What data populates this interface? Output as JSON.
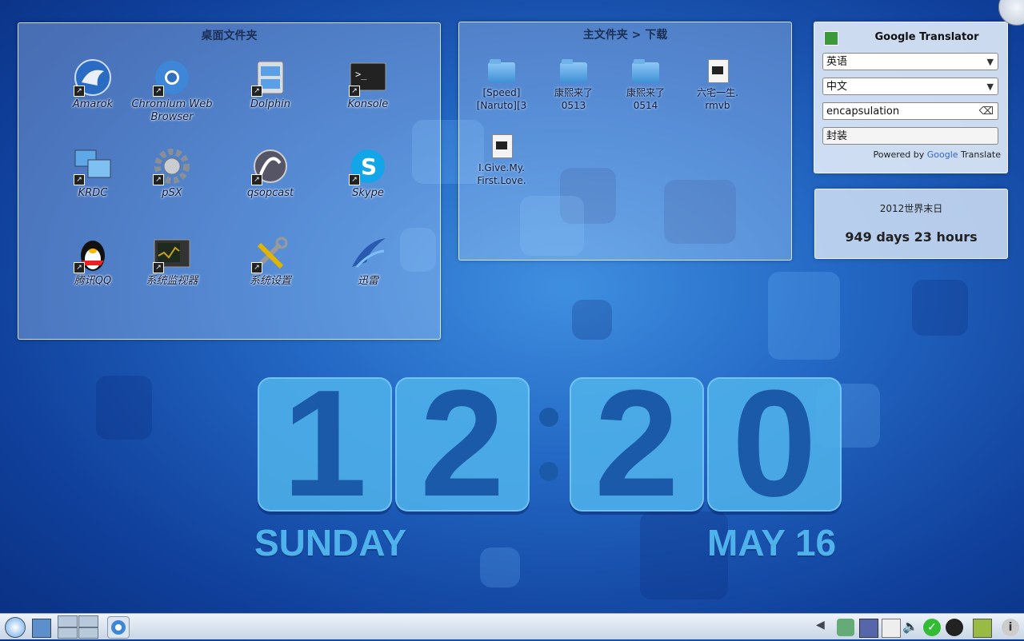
{
  "desktop_panel": {
    "title": "桌面文件夹",
    "icons": [
      {
        "label": "Amarok",
        "icon": "amarok-icon"
      },
      {
        "label": "Chromium Web Browser",
        "icon": "chromium-icon"
      },
      {
        "label": "Dolphin",
        "icon": "dolphin-icon"
      },
      {
        "label": "Konsole",
        "icon": "konsole-icon"
      },
      {
        "label": "KRDC",
        "icon": "krdc-icon"
      },
      {
        "label": "pSX",
        "icon": "psx-gear-icon"
      },
      {
        "label": "qsopcast",
        "icon": "qsopcast-icon"
      },
      {
        "label": "Skype",
        "icon": "skype-icon"
      },
      {
        "label": "腾讯QQ",
        "icon": "qq-penguin-icon"
      },
      {
        "label": "系统监视器",
        "icon": "system-monitor-icon"
      },
      {
        "label": "系统设置",
        "icon": "system-settings-icon"
      },
      {
        "label": "迅雷",
        "icon": "xunlei-icon"
      }
    ]
  },
  "home_panel": {
    "title": "主文件夹 > 下载",
    "files": [
      {
        "label": "[Speed]\n[Naruto][3",
        "type": "folder-icon"
      },
      {
        "label": "康熙来了\n0513",
        "type": "folder-icon"
      },
      {
        "label": "康熙来了\n0514",
        "type": "folder-icon"
      },
      {
        "label": "六宅一生.\nrmvb",
        "type": "video-file-icon"
      },
      {
        "label": "I.Give.My.\nFirst.Love.",
        "type": "video-file-icon"
      }
    ]
  },
  "translator": {
    "title": "Google Translator",
    "from_lang": "英语",
    "to_lang": "中文",
    "input_text": "encapsulation",
    "output_text": "封装",
    "powered_by": "Powered by",
    "google": "Google",
    "translate": "Translate"
  },
  "countdown": {
    "title": "2012世界末日",
    "value": "949 days 23 hours"
  },
  "clock": {
    "h1": "1",
    "h2": "2",
    "m1": "2",
    "m2": "0",
    "day": "SUNDAY",
    "date": "MAY 16"
  },
  "taskbar": {
    "icons": [
      "kickoff-menu-icon",
      "desktop-icon",
      "pager-icon",
      "chromium-icon",
      "arrow-left-icon",
      "network-icon",
      "display-icon",
      "clipboard-icon",
      "volume-icon",
      "check-icon",
      "qq-icon",
      "notes-icon",
      "info-icon"
    ]
  },
  "colors": {
    "accent": "#2368c4",
    "clock_digit": "#1b5aa8",
    "date_text": "#4fb2ea"
  }
}
